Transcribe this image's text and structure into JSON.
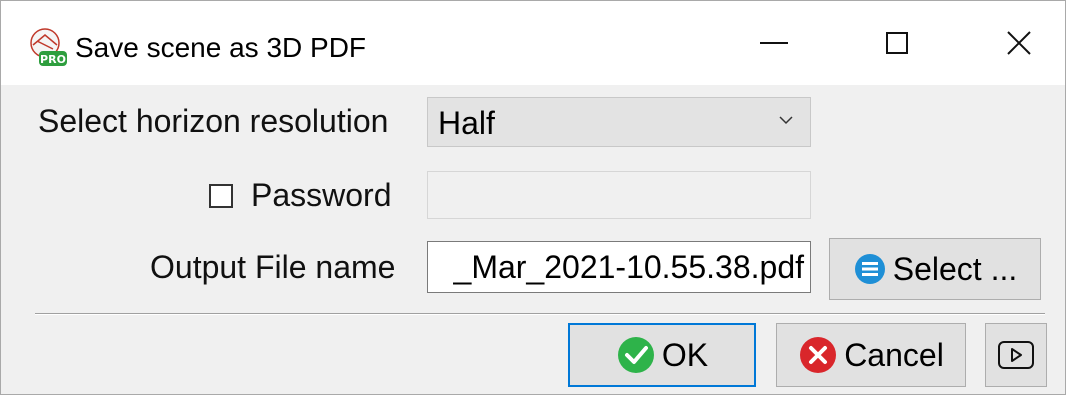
{
  "window": {
    "title": "Save scene as 3D PDF",
    "app_icon": "pro-app-icon",
    "controls": [
      "minimize-icon",
      "maximize-icon",
      "close-icon"
    ]
  },
  "form": {
    "resolution_label": "Select horizon resolution",
    "resolution_value": "Half",
    "password_label": "Password",
    "password_checked": false,
    "password_value": "",
    "output_label": "Output File name",
    "output_value": "_Mar_2021-10.55.38.pdf"
  },
  "buttons": {
    "select_label": "Select ...",
    "ok_label": "OK",
    "cancel_label": "Cancel",
    "more_icon": "play-icon"
  },
  "colors": {
    "accent": "#0078d7",
    "ok_icon": "#2eb34a",
    "cancel_icon": "#d9262b",
    "select_icon": "#1e8fd6"
  }
}
